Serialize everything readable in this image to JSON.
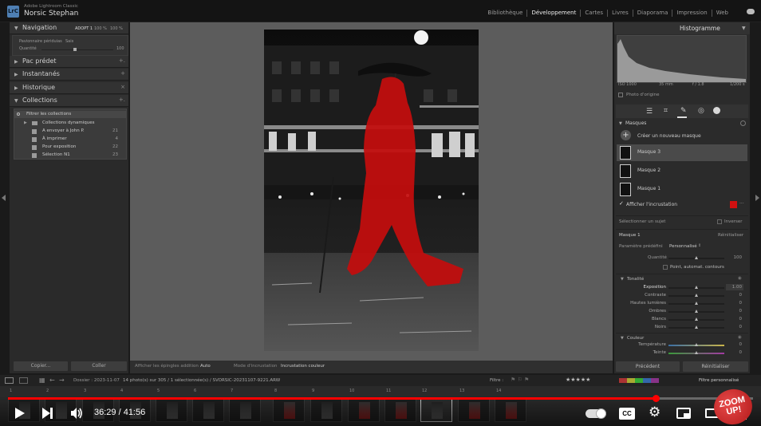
{
  "titlebar": {
    "app_name": "Adobe Lightroom Classic",
    "logo": "LrC",
    "user": "Norsic Stephan",
    "modules": [
      "Bibliothèque",
      "Développement",
      "Cartes",
      "Livres",
      "Diaporama",
      "Impression",
      "Web"
    ],
    "active_module": "Développement"
  },
  "left_panel": {
    "navigation": {
      "title": "Navigation",
      "zoom": [
        "ADOPT 1",
        "100 %",
        "100 %"
      ]
    },
    "nav_box": {
      "line1_a": "Pavionnaire périduias",
      "line1_b": "Sais",
      "line2": "Quantité",
      "value": "100"
    },
    "sections": [
      {
        "label": "Pac prédet"
      },
      {
        "label": "Instantanés"
      },
      {
        "label": "Historique"
      },
      {
        "label": "Collections"
      }
    ],
    "collections": {
      "filter": "Filtrer les collections",
      "items": [
        {
          "label": "Collections dynamiques",
          "count": ""
        },
        {
          "label": "A envoyer à John P.",
          "count": "21"
        },
        {
          "label": "À imprimer",
          "count": "4"
        },
        {
          "label": "Pour exposition",
          "count": "22"
        },
        {
          "label": "Sélection N1",
          "count": "23"
        }
      ]
    },
    "buttons": {
      "copy": "Copier...",
      "paste": "Coller"
    }
  },
  "toolbar": {
    "show_edges": "Afficher les épingles addition",
    "auto": "Auto",
    "overlay_mode": "Mode d'incrustation",
    "overlay_color": "Incrustation couleur"
  },
  "right_panel": {
    "histogram": {
      "title": "Histogramme",
      "iso": "ISO 1000",
      "focal": "35 mm",
      "aperture": "f / 1.8",
      "shutter": "1/200 s",
      "original": "Photo d'origine"
    },
    "masks": {
      "title": "Masques",
      "create": "Créer un nouveau masque",
      "items": [
        "Masque 3",
        "Masque 2",
        "Masque 1"
      ],
      "show_overlay": "Afficher l'incrustation",
      "overlay_color": "#d01010"
    },
    "subject": {
      "label": "Sélectionner un sujet",
      "invert": "Inverser"
    },
    "mask_panel": {
      "title": "Masque 1",
      "reset": "Réinitialiser",
      "preset_label": "Paramètre prédéfini",
      "preset_value": "Personnalisé",
      "amount_label": "Quantité",
      "amount_value": "100",
      "auto_toning": "Point, automat. contours"
    },
    "tone": {
      "title": "Tonalité",
      "sliders": [
        {
          "label": "Exposition",
          "value": "1.00",
          "level": 0.5
        },
        {
          "label": "Contraste",
          "value": "0",
          "level": 0.5
        },
        {
          "label": "Hautes lumières",
          "value": "0",
          "level": 0.5
        },
        {
          "label": "Ombres",
          "value": "0",
          "level": 0.5
        },
        {
          "label": "Blancs",
          "value": "0",
          "level": 0.5
        },
        {
          "label": "Noirs",
          "value": "0",
          "level": 0.5
        }
      ]
    },
    "color": {
      "title": "Couleur",
      "sliders": [
        {
          "label": "Température",
          "value": "0",
          "level": 0.5
        },
        {
          "label": "Teinte",
          "value": "0",
          "level": 0.5
        }
      ]
    },
    "buttons": {
      "previous": "Précédent",
      "reset": "Réinitialiser"
    }
  },
  "filmbar": {
    "folder": "Dossier : 2023-11-07",
    "info": "14 photo(s) sur 305 / 1 sélectionnée(s) / SVORSIC-20231107-9221.ARW",
    "filter_label": "Filtre :",
    "filter_value": "Filtre personnalisé",
    "frame_numbers": [
      "1",
      "2",
      "3",
      "4",
      "5",
      "6",
      "7",
      "8",
      "9",
      "10",
      "11",
      "12",
      "13",
      "14"
    ]
  },
  "video": {
    "time": "36:29 / 41:56",
    "progress": 0.87,
    "badge": "ZOOM UP!",
    "colors": {
      "progress": "#ff0000"
    }
  }
}
